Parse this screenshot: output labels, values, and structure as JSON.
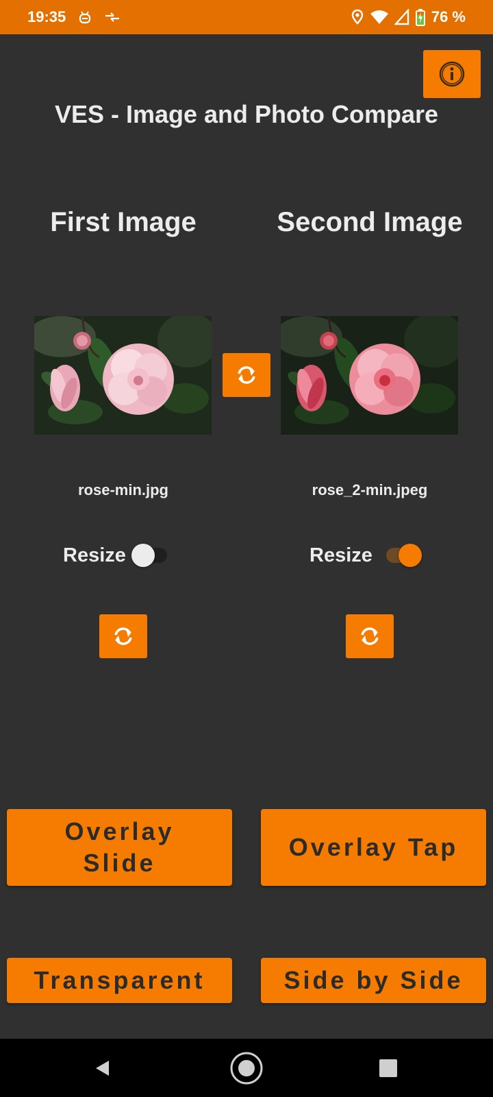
{
  "status_bar": {
    "time": "19:35",
    "battery": "76 %",
    "icons": [
      "usb-debug-icon",
      "data-transfer-icon",
      "location-icon",
      "wifi-icon",
      "signal-icon",
      "battery-charging-icon"
    ]
  },
  "header": {
    "title": "VES - Image and Photo Compare",
    "info_icon": "info-icon"
  },
  "first": {
    "heading": "First Image",
    "filename": "rose-min.jpg",
    "resize_label": "Resize",
    "resize_on": false
  },
  "second": {
    "heading": "Second Image",
    "filename": "rose_2-min.jpeg",
    "resize_label": "Resize",
    "resize_on": true
  },
  "swap_icon": "swap-arrows-icon",
  "buttons": {
    "overlay_slide": "Overlay Slide",
    "overlay_tap": "Overlay Tap",
    "transparent": "Transparent",
    "side_by_side": "Side by Side"
  },
  "nav": [
    "back-icon",
    "home-icon",
    "recents-icon"
  ],
  "colors": {
    "accent": "#f57c00",
    "status_bar": "#e37000",
    "background": "#303030"
  }
}
